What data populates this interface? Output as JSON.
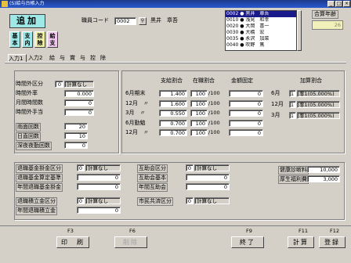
{
  "window": {
    "title": "(S)給与台帳入力"
  },
  "header": {
    "mode": "追加",
    "emp_code_label": "職員コード",
    "emp_code": "0002",
    "emp_name": "黒井　章吾",
    "aggregate_label": "合算年齢",
    "aggregate_value": "26"
  },
  "side_buttons": [
    {
      "label": "基本",
      "color": "#9ee8e8"
    },
    {
      "label": "支内",
      "color": "#9ee8e8"
    },
    {
      "label": "控除",
      "color": "#f0f0a8"
    },
    {
      "label": "給支",
      "color": "#f0c8f0"
    }
  ],
  "employee_list": [
    {
      "code": "0002",
      "mark": "●",
      "name": "黒井　章吾",
      "selected": true
    },
    {
      "code": "0010",
      "mark": "●",
      "name": "浅見　和幸",
      "selected": false
    },
    {
      "code": "0020",
      "mark": "●",
      "name": "大岡　喜一",
      "selected": false
    },
    {
      "code": "0030",
      "mark": "●",
      "name": "大橋　宏",
      "selected": false
    },
    {
      "code": "0035",
      "mark": "●",
      "name": "永沢　加菜",
      "selected": false
    },
    {
      "code": "0040",
      "mark": "●",
      "name": "吹野　篤",
      "selected": false
    }
  ],
  "tabs": [
    "入力1",
    "入力2",
    "給",
    "与",
    "賞",
    "与",
    "控",
    "除"
  ],
  "left_panel": {
    "rows1": [
      {
        "label": "時間外区分",
        "value": "0",
        "text": "計算なし"
      },
      {
        "label": "時間外率",
        "value": "0.000"
      },
      {
        "label": "月間時間数",
        "value": "0"
      },
      {
        "label": "時間外手当",
        "value": "0"
      }
    ],
    "rows2": [
      {
        "label": "雨面回数",
        "value": "20"
      },
      {
        "label": "日直回数",
        "value": "10"
      },
      {
        "label": "深夜夜勤回数",
        "value": "0"
      }
    ]
  },
  "center_panel": {
    "col_headers": [
      "支給割合",
      "在職割合",
      "金額固定",
      "加算割合"
    ],
    "rows": [
      {
        "label": "6月期末",
        "rate": "1.400",
        "emp": "100",
        "div": "/100",
        "fixed": "0"
      },
      {
        "label": "12月　〃",
        "rate": "1.600",
        "emp": "100",
        "div": "/100",
        "fixed": "0"
      },
      {
        "label": "3月　〃",
        "rate": "0.550",
        "emp": "100",
        "div": "/100",
        "fixed": "0"
      },
      {
        "label": "6月勤勉",
        "rate": "0.700",
        "emp": "100",
        "div": "/100",
        "fixed": "0"
      },
      {
        "label": "12月　〃",
        "rate": "0.700",
        "emp": "100",
        "div": "/100",
        "fixed": "0"
      }
    ],
    "add_rows": [
      {
        "label": "6月",
        "code": "1",
        "text": "率1(05.000%)"
      },
      {
        "label": "12月",
        "code": "1",
        "text": "率1(05.000%)"
      },
      {
        "label": "3月",
        "code": "1",
        "text": "率1(05.000%)"
      }
    ]
  },
  "bottom_panel": {
    "group1": [
      {
        "label": "退職基金掛金区分",
        "value": "0",
        "text": "計算なし"
      },
      {
        "label": "退職基金算定基準",
        "value": "0"
      },
      {
        "label": "年間退職基金掛金",
        "value": "0"
      }
    ],
    "group2": [
      {
        "label": "退職積立金区分",
        "value": "0",
        "text": "計算なし"
      },
      {
        "label": "年間退職積立金",
        "value": "0"
      }
    ],
    "group3": [
      {
        "label": "互助会区分",
        "value": "0",
        "text": "計算なし"
      },
      {
        "label": "互助会基本",
        "value": "0"
      },
      {
        "label": "年間互助会",
        "value": "0"
      }
    ],
    "group4": [
      {
        "label": "市民共済区分",
        "value": "0",
        "text": "計算なし"
      }
    ],
    "group5": [
      {
        "label": "健康診断料",
        "value": "10,000"
      },
      {
        "label": "厚生福利費",
        "value": "3,000"
      }
    ]
  },
  "footer": {
    "fkeys": [
      {
        "key": "F3",
        "label": "印　刷",
        "enabled": true
      },
      {
        "key": "F6",
        "label": "削除",
        "enabled": false
      },
      {
        "key": "F9",
        "label": "終了",
        "enabled": true
      },
      {
        "key": "F11",
        "label": "計算",
        "enabled": true
      },
      {
        "key": "F12",
        "label": "登録",
        "enabled": true
      }
    ]
  }
}
